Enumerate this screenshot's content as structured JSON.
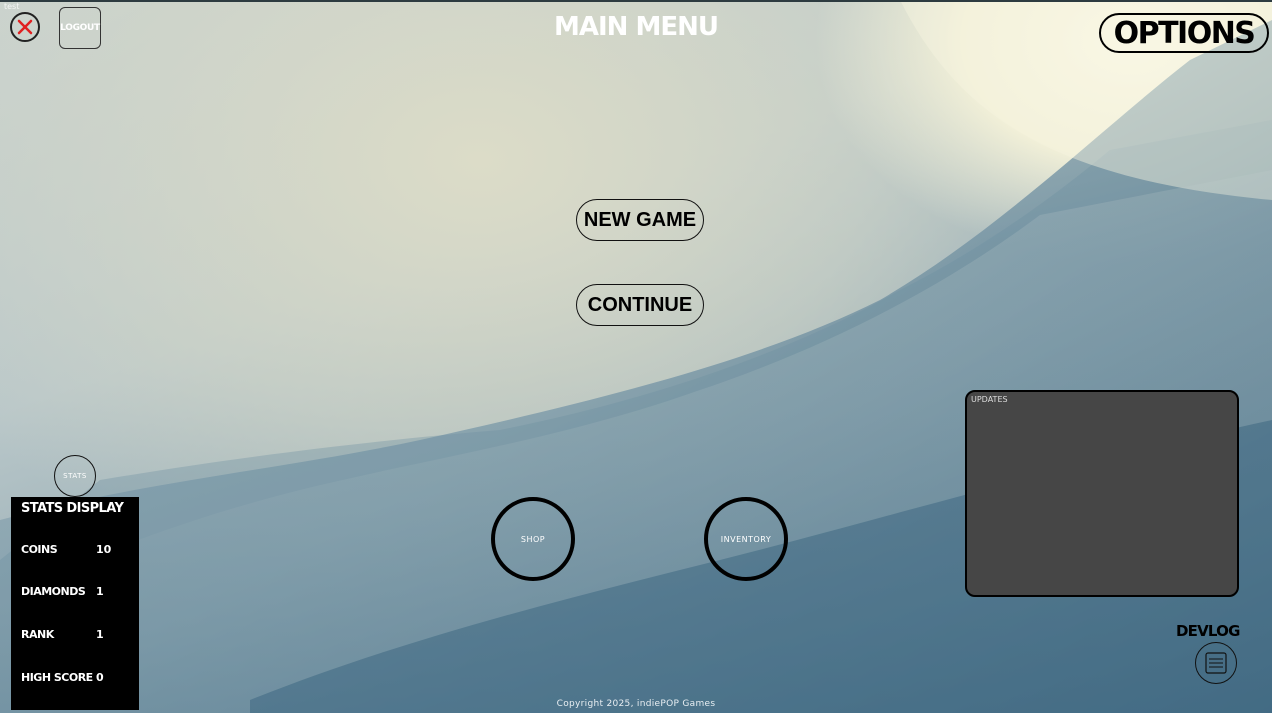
{
  "window": {
    "corner_label": "test"
  },
  "header": {
    "title": "MAIN MENU",
    "logout_label": "LOGOUT",
    "options_label": "OPTIONS"
  },
  "menu": {
    "new_game_label": "NEW GAME",
    "continue_label": "CONTINUE"
  },
  "nav": {
    "shop_label": "SHOP",
    "inventory_label": "INVENTORY",
    "stats_label": "STATS"
  },
  "stats_panel": {
    "title": "STATS DISPLAY",
    "rows": [
      {
        "label": "COINS",
        "value": "10"
      },
      {
        "label": "DIAMONDS",
        "value": "1"
      },
      {
        "label": "RANK",
        "value": "1"
      },
      {
        "label": "HIGH SCORE",
        "value": "0"
      }
    ]
  },
  "updates": {
    "label": "UPDATES"
  },
  "devlog": {
    "label": "DEVLOG"
  },
  "footer": {
    "copyright": "Copyright 2025, indiePOP Games"
  },
  "icons": {
    "close": "close-icon",
    "devlog": "document-icon"
  },
  "colors": {
    "close_x": "#e02020",
    "panel_bg": "#000000",
    "updates_bg": "#464646"
  }
}
